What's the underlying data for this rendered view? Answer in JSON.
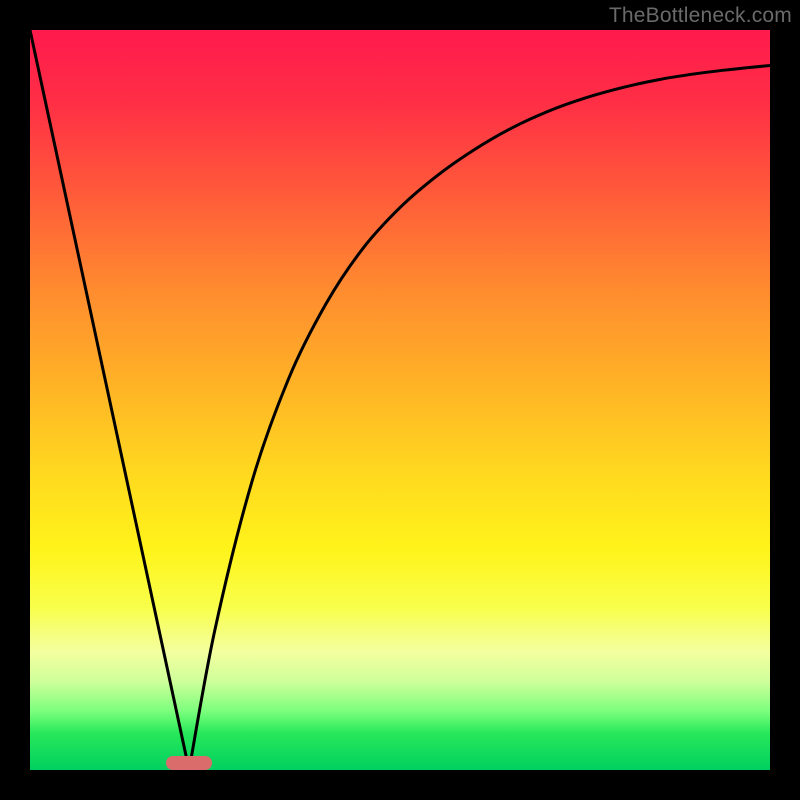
{
  "watermark": "TheBottleneck.com",
  "marker": {
    "x_frac": 0.215,
    "y_frac": 1.0
  },
  "colors": {
    "curve": "#000000",
    "frame": "#000000",
    "marker": "#da6c6c",
    "gradient_top": "#ff1a4d",
    "gradient_bottom": "#00d060"
  },
  "chart_data": {
    "type": "line",
    "title": "",
    "xlabel": "",
    "ylabel": "",
    "xlim": [
      0,
      1
    ],
    "ylim": [
      0,
      1
    ],
    "series": [
      {
        "name": "left-line",
        "x": [
          0.0,
          0.215
        ],
        "y": [
          1.0,
          0.0
        ]
      },
      {
        "name": "right-curve",
        "x": [
          0.215,
          0.25,
          0.3,
          0.35,
          0.4,
          0.45,
          0.5,
          0.55,
          0.6,
          0.65,
          0.7,
          0.75,
          0.8,
          0.85,
          0.9,
          0.95,
          1.0
        ],
        "y": [
          0.0,
          0.19,
          0.39,
          0.53,
          0.63,
          0.705,
          0.76,
          0.803,
          0.838,
          0.867,
          0.89,
          0.908,
          0.922,
          0.933,
          0.941,
          0.947,
          0.952
        ]
      }
    ],
    "annotations": [
      {
        "name": "min-marker",
        "x": 0.215,
        "y": 0.0
      }
    ],
    "background": "vertical rainbow gradient red→green",
    "grid": false,
    "legend": false
  }
}
